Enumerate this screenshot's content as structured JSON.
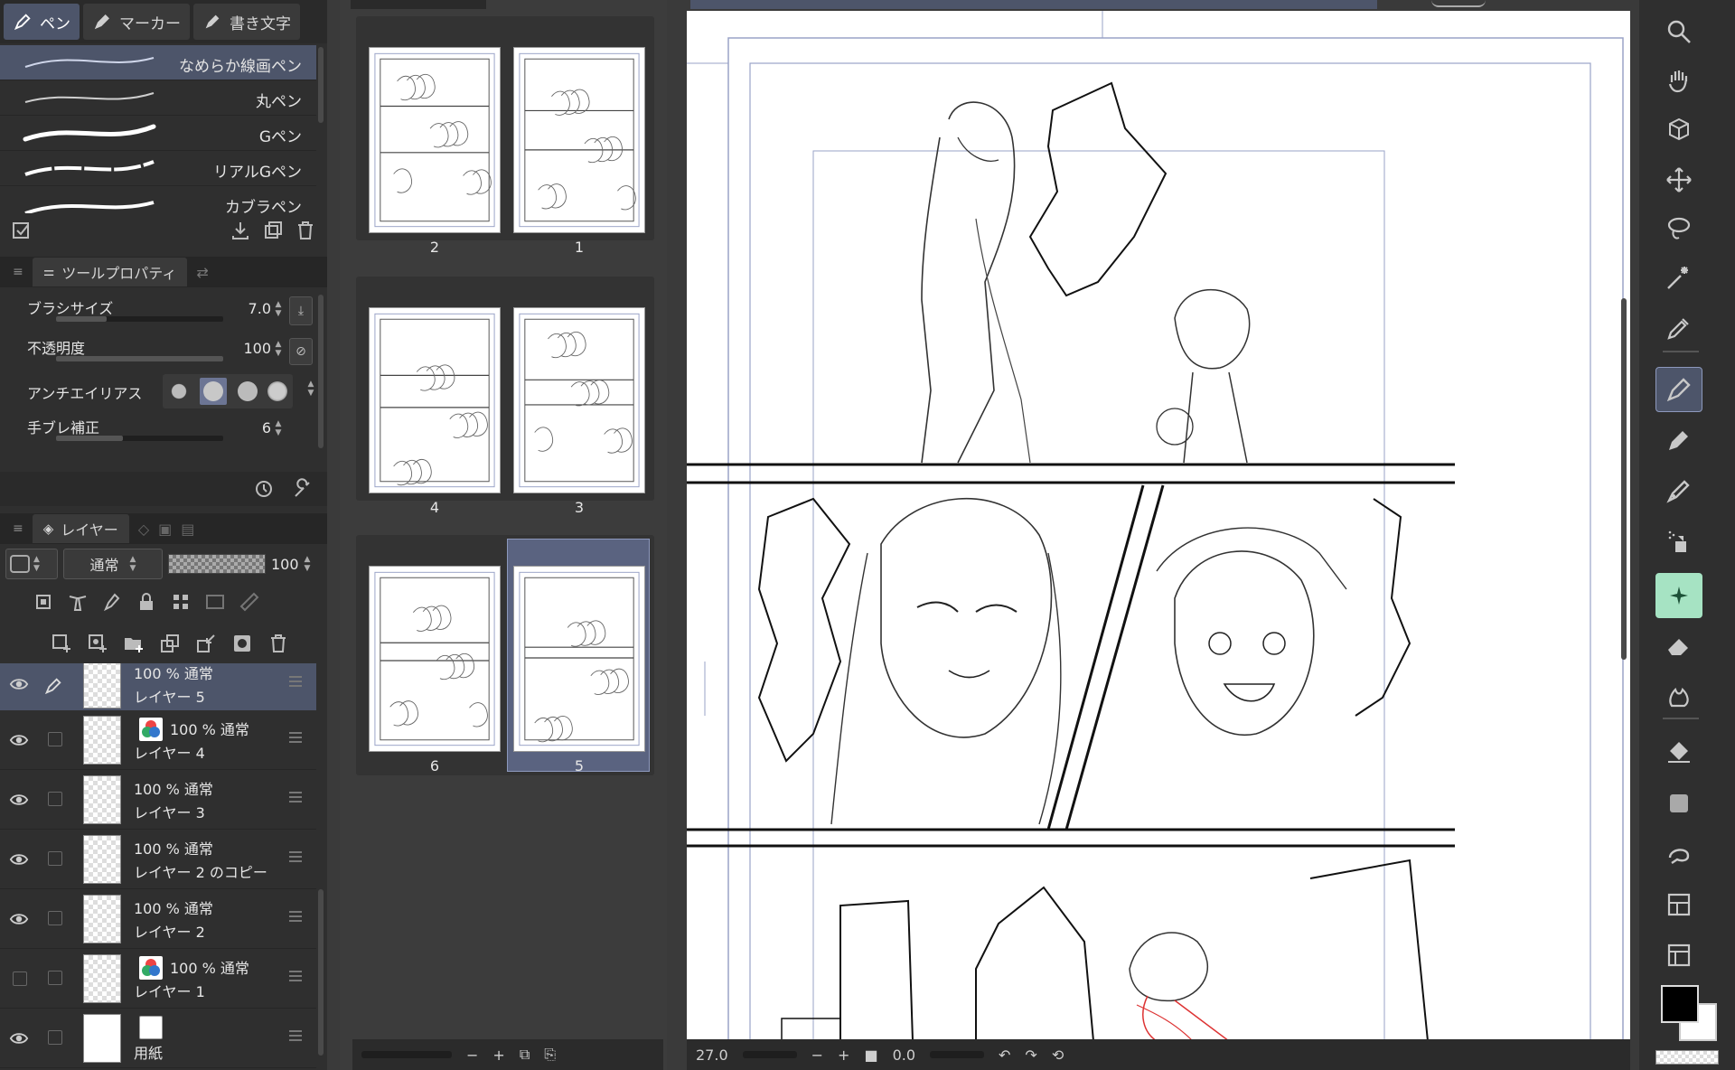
{
  "top_tabs": [
    "ペン",
    "マーカー",
    "書き文字"
  ],
  "brushes": [
    {
      "name": "なめらか線画ペン",
      "selected": true
    },
    {
      "name": "丸ペン",
      "selected": false
    },
    {
      "name": "Gペン",
      "selected": false
    },
    {
      "name": "リアルGペン",
      "selected": false
    },
    {
      "name": "カブラペン",
      "selected": false
    }
  ],
  "tool_property": {
    "panel_title": "ツールプロパティ",
    "brush_size": {
      "label": "ブラシサイズ",
      "value": "7.0",
      "fill": 0.3
    },
    "opacity": {
      "label": "不透明度",
      "value": "100",
      "fill": 1.0
    },
    "antialias": {
      "label": "アンチエイリアス"
    },
    "stabilization": {
      "label": "手ブレ補正",
      "value": "6",
      "fill": 0.4
    }
  },
  "layer_panel": {
    "tab_label": "レイヤー",
    "blend_mode": "通常",
    "opacity_value": "100",
    "layers": [
      {
        "line1": "100 % 通常",
        "name": "レイヤー 5",
        "visible": true,
        "selected": true,
        "pen": true,
        "color": false
      },
      {
        "line1": "100 % 通常",
        "name": "レイヤー 4",
        "visible": true,
        "selected": false,
        "pen": false,
        "color": true
      },
      {
        "line1": "100 % 通常",
        "name": "レイヤー 3",
        "visible": true,
        "selected": false,
        "pen": false,
        "color": false
      },
      {
        "line1": "100 % 通常",
        "name": "レイヤー 2 のコピー",
        "visible": true,
        "selected": false,
        "pen": false,
        "color": false
      },
      {
        "line1": "100 % 通常",
        "name": "レイヤー 2",
        "visible": true,
        "selected": false,
        "pen": false,
        "color": false
      },
      {
        "line1": "100 % 通常",
        "name": "レイヤー 1",
        "visible": false,
        "selected": false,
        "pen": false,
        "color": true
      },
      {
        "line1": "",
        "name": "用紙",
        "visible": true,
        "selected": false,
        "pen": false,
        "color": false,
        "paper": true
      }
    ]
  },
  "pages": [
    {
      "left": "2",
      "right": "1"
    },
    {
      "left": "4",
      "right": "3"
    },
    {
      "left": "6",
      "right": "5",
      "selected": "right"
    }
  ],
  "canvas_bar": {
    "zoom": "27.0",
    "rotation": "0.0"
  },
  "right_tools": [
    "zoom-icon",
    "hand-icon",
    "object-icon",
    "move-icon",
    "lasso-icon",
    "magic-wand-icon",
    "eyedropper-icon",
    "pen-tool-icon",
    "pencil-icon",
    "brush-icon",
    "airbrush-icon",
    "decoration-icon",
    "eraser-icon",
    "blend-icon",
    "fill-icon",
    "gradient-icon",
    "figure-icon",
    "frame-icon",
    "ruler-icon"
  ],
  "colors": {
    "accent": "#4d556a",
    "accent_border": "#8d99bd",
    "decoration_tool": "#a6e3c3",
    "main_color": "#000000",
    "sub_color": "#ffffff"
  }
}
